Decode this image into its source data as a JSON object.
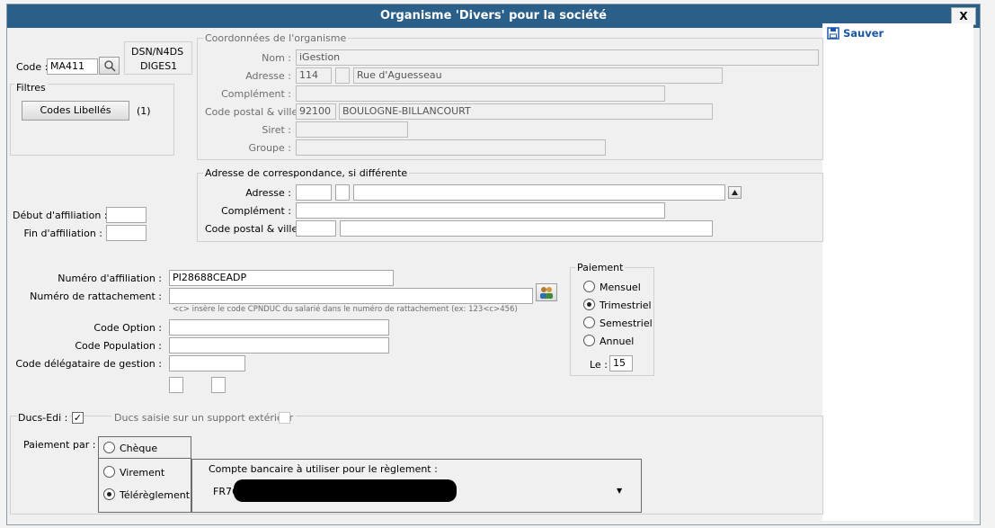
{
  "window": {
    "title": "Organisme 'Divers' pour la société",
    "close": "X"
  },
  "toolbar": {
    "save": "Sauver"
  },
  "header": {
    "code_label": "Code :",
    "code_value": "MA411",
    "dsn_label": "DSN/N4DS",
    "dsn_value": "DIGES1"
  },
  "filters": {
    "label": "Filtres",
    "button": "Codes Libellés",
    "count": "(1)"
  },
  "org_coords": {
    "legend": "Coordonnées de l'organisme",
    "nom_label": "Nom :",
    "nom": "iGestion",
    "adresse_label": "Adresse :",
    "adresse_num": "114",
    "adresse_ext": "",
    "adresse_rue": "Rue d'Aguesseau",
    "complement_label": "Complément :",
    "complement": "",
    "cp_label": "Code postal & ville :",
    "cp": "92100",
    "ville": "BOULOGNE-BILLANCOURT",
    "siret_label": "Siret :",
    "siret": "",
    "groupe_label": "Groupe :",
    "groupe": ""
  },
  "corresp": {
    "legend": "Adresse de correspondance, si différente",
    "adresse_label": "Adresse :",
    "complement_label": "Complément :",
    "cp_label": "Code postal & ville :"
  },
  "affiliation": {
    "debut_label": "Début d'affiliation :",
    "fin_label": "Fin d'affiliation :"
  },
  "numbers": {
    "num_affil_label": "Numéro d'affiliation :",
    "num_affil": "PI28688CEADP",
    "num_ratt_label": "Numéro de rattachement :",
    "num_ratt": "",
    "hint": "<c> insère le code CPNDUC du salarié dans le numéro de rattachement (ex: 123<c>456)",
    "code_option_label": "Code Option :",
    "code_population_label": "Code Population :",
    "code_delegataire_label": "Code délégataire de gestion :"
  },
  "paiement": {
    "legend": "Paiement",
    "options": [
      "Mensuel",
      "Trimestriel",
      "Semestriel",
      "Annuel"
    ],
    "selected": "Trimestriel",
    "le_label": "Le :",
    "le_value": "15"
  },
  "ducs": {
    "ducs_edi_label": "Ducs-Edi :",
    "ducs_edi_checked": true,
    "support_label": "Ducs saisie sur un support extérieur",
    "support_checked": false
  },
  "payment_by": {
    "label": "Paiement par :",
    "options": [
      "Chèque",
      "Virement",
      "Télérèglement"
    ],
    "selected": "Télérèglement",
    "account_label": "Compte bancaire à utiliser pour le règlement :",
    "account_value": "FR76"
  },
  "colors": {
    "titlebar": "#2a5f8a",
    "accent": "#1a56a8"
  }
}
